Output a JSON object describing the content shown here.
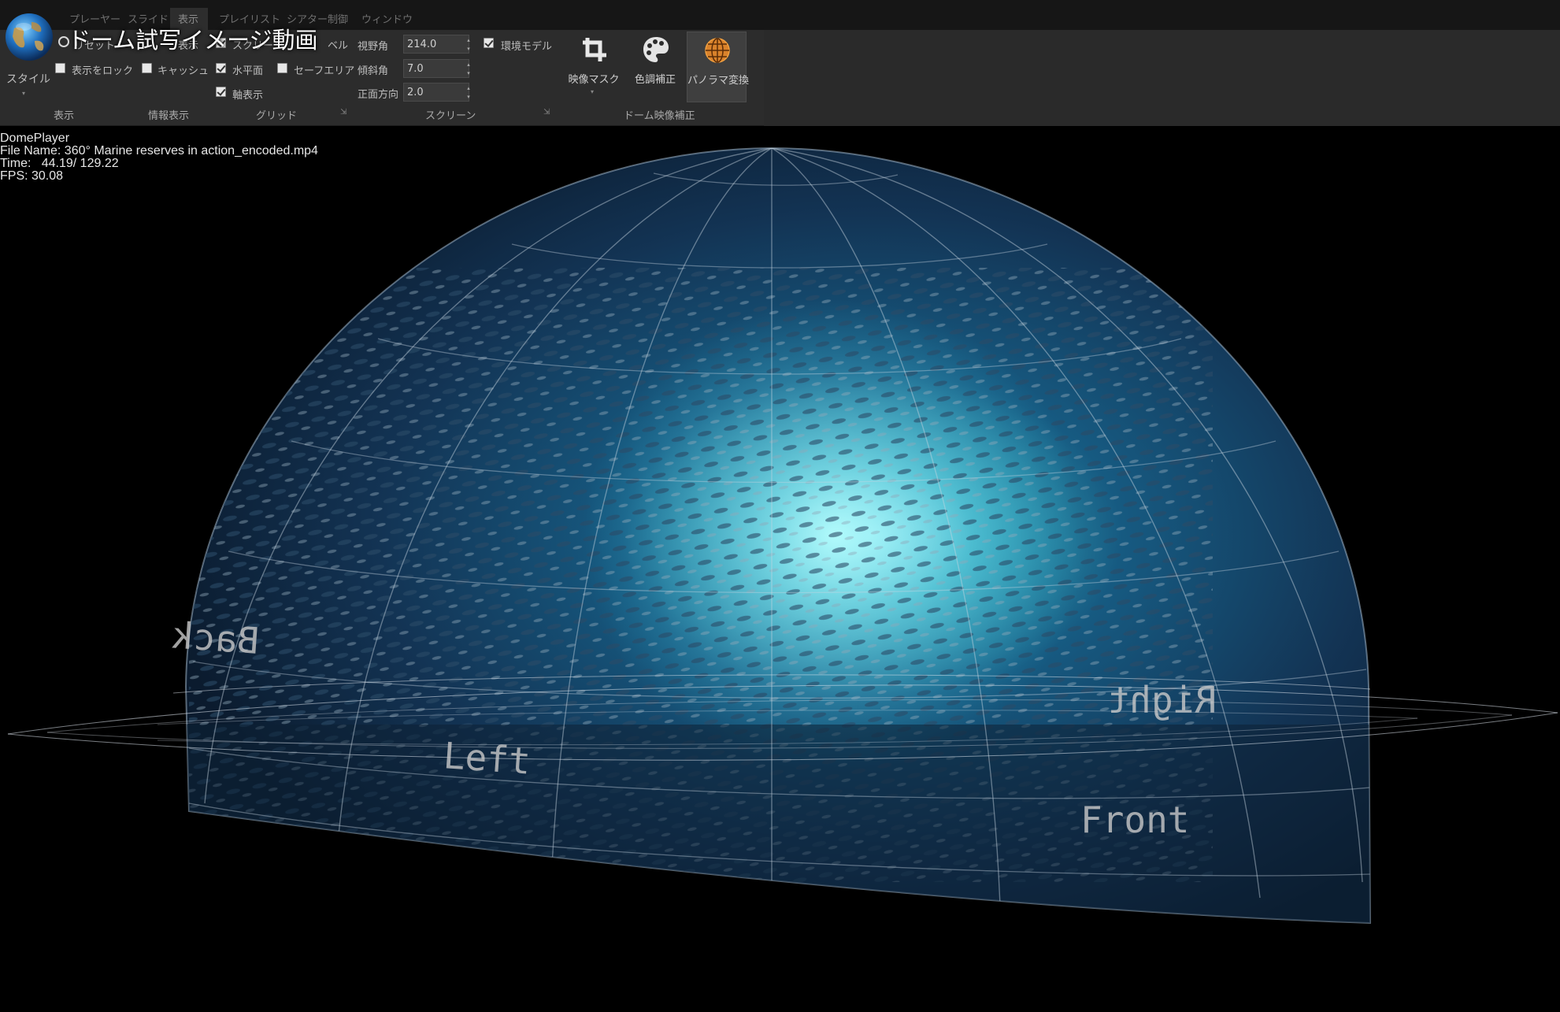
{
  "menu": {
    "items": [
      "プレーヤー",
      "スライド",
      "表示",
      "プレイリスト",
      "シアター制御",
      "ウィンドウ"
    ],
    "active": "表示"
  },
  "overlay_title": "ドーム試写イメージ動画",
  "ribbon": {
    "style_button": "スタイル",
    "display_group": {
      "reset_partial": "リセット",
      "lock_label": "表示をロック",
      "group_label": "表示"
    },
    "info_group": {
      "partial_label": "表示",
      "cache_label": "キャッシュ",
      "group_label": "情報表示"
    },
    "grid_group": {
      "screen_partial": "スクリーン",
      "horizon_label": "水平面",
      "axis_label": "軸表示",
      "safe_area_label": "セーフエリア",
      "level_partial": "ベル",
      "group_label": "グリッド"
    },
    "screen_group": {
      "fov_label": "視野角",
      "fov_value": "214.0",
      "tilt_label": "傾斜角",
      "tilt_value": "7.0",
      "front_label": "正面方向",
      "front_value": "2.0",
      "env_model_label": "環境モデル",
      "group_label": "スクリーン"
    },
    "dome_group": {
      "mask_label": "映像マスク",
      "color_label": "色調補正",
      "panorama_label": "パノラマ変換",
      "group_label": "ドーム映像補正"
    },
    "checks": {
      "lock": false,
      "cache": false,
      "screen": true,
      "horizon": true,
      "axis": true,
      "safe_area": false,
      "env_model": true
    }
  },
  "info": {
    "app": "DomePlayer",
    "file": "File Name: 360° Marine reserves in action_encoded.mp4",
    "time": "Time:   44.19/ 129.22",
    "fps": "FPS: 30.08"
  },
  "dome_labels": {
    "back": "Back",
    "left": "Left",
    "right": "Right",
    "front": "Front"
  },
  "colors": {
    "ribbon_bg": "#2c2c2c",
    "menubar_bg": "#161616",
    "water_glow": "#5fe8f0",
    "dome_blue": "#1d4a78",
    "grid_line": "#c8d4e0"
  }
}
